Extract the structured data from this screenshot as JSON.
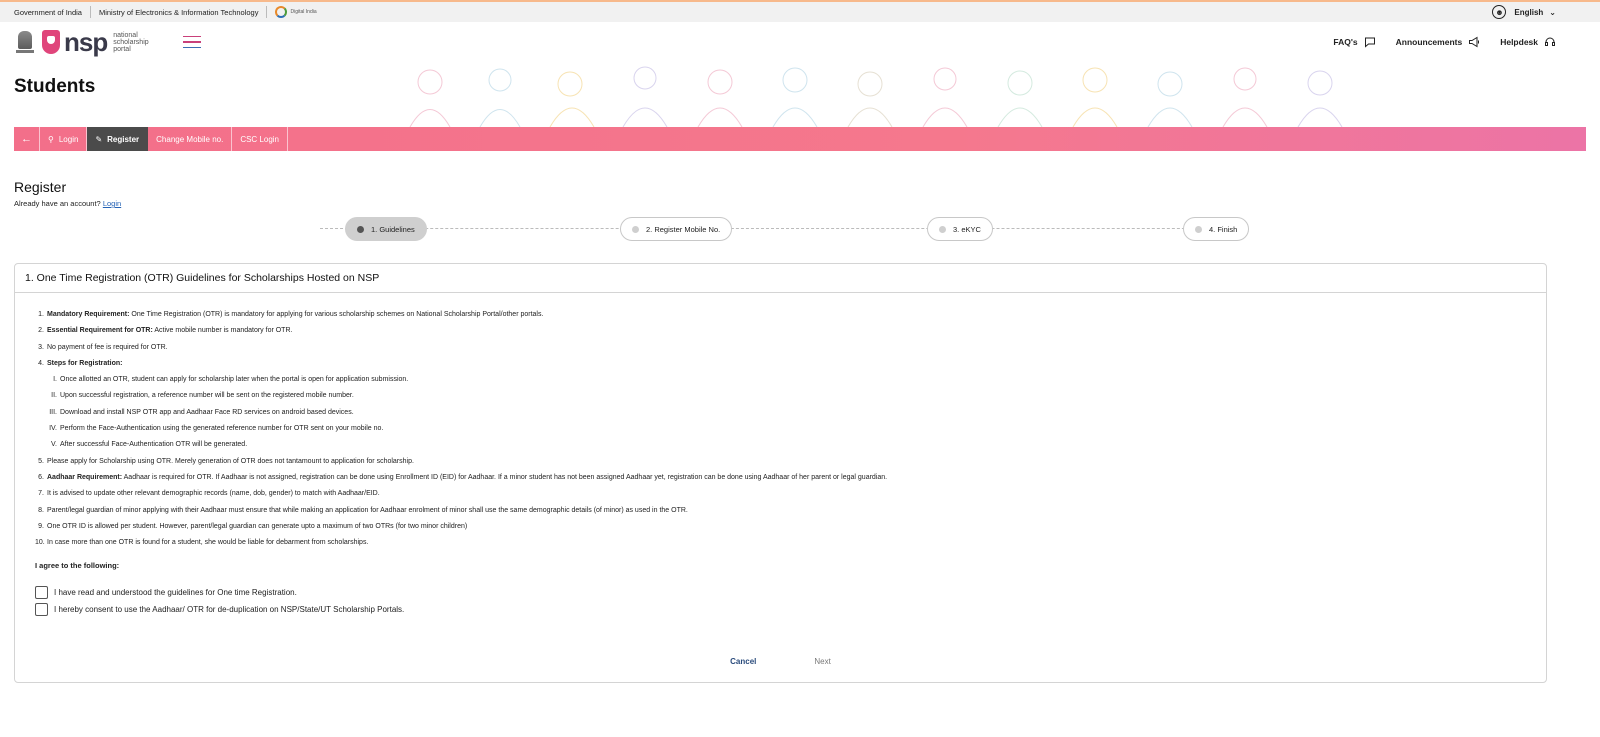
{
  "govbar": {
    "gov": "Government of India",
    "ministry": "Ministry of Electronics & Information Technology",
    "digital_india": "Digital India",
    "language": "English"
  },
  "header": {
    "logo_text": "nsp",
    "logo_sub_1": "national",
    "logo_sub_2": "scholarship",
    "logo_sub_3": "portal",
    "nav": {
      "faq": "FAQ's",
      "announcements": "Announcements",
      "helpdesk": "Helpdesk"
    }
  },
  "hero": {
    "title": "Students"
  },
  "tabs": {
    "login": "Login",
    "register": "Register",
    "change_mobile": "Change Mobile no.",
    "csc_login": "CSC Login"
  },
  "register": {
    "title": "Register",
    "already": "Already have an account?",
    "login_link": "Login"
  },
  "steps": [
    "1. Guidelines",
    "2. Register Mobile No.",
    "3. eKYC",
    "4. Finish"
  ],
  "card": {
    "title": "1. One Time Registration (OTR) Guidelines for Scholarships Hosted on NSP",
    "g1_label": "Mandatory Requirement:",
    "g1_text": " One Time Registration (OTR) is mandatory for applying for various scholarship schemes on National Scholarship Portal/other portals.",
    "g2_label": "Essential Requirement for OTR:",
    "g2_text": " Active mobile number is mandatory for OTR.",
    "g3_text": "No payment of fee is required for OTR.",
    "g4_label": "Steps for Registration:",
    "s1": "Once allotted an OTR, student can apply for scholarship later when the portal is open for application submission.",
    "s2": "Upon successful registration, a reference number will be sent on the registered mobile number.",
    "s3": "Download and install NSP OTR app and Aadhaar Face RD services on android based devices.",
    "s4": "Perform the Face-Authentication using the generated reference number for OTR sent on your mobile no.",
    "s5": "After successful Face-Authentication OTR will be generated.",
    "g5_text": "Please apply for Scholarship using OTR. Merely generation of OTR does not tantamount to application for scholarship.",
    "g6_label": "Aadhaar Requirement:",
    "g6_text": " Aadhaar is required for OTR. If Aadhaar is not assigned, registration can be done using Enrollment ID (EID) for Aadhaar. If a minor student has not been assigned Aadhaar yet, registration can be done using Aadhaar of her parent or legal guardian.",
    "g7_text": "It is advised to update other relevant demographic records (name, dob, gender) to match with Aadhaar/EID.",
    "g8_text": "Parent/legal guardian of minor applying with their Aadhaar must ensure that while making an application for Aadhaar enrolment of minor shall use the same demographic details (of minor) as used in the OTR.",
    "g9_text": "One OTR ID is allowed per student. However, parent/legal guardian can generate upto a maximum of two OTRs (for two minor children)",
    "g10_text": "In case more than one OTR is found for a student, she would be liable for debarment from scholarships.",
    "agree": "I agree to the following:",
    "check1": "I have read and understood the guidelines for One time Registration.",
    "check2": "I hereby consent to use the Aadhaar/ OTR for de-duplication on NSP/State/UT Scholarship Portals.",
    "cancel": "Cancel",
    "next": "Next"
  },
  "colors": {
    "accent_pink": "#f36f8a",
    "active_tab": "#4b4b4b",
    "link_blue": "#2563b6"
  }
}
